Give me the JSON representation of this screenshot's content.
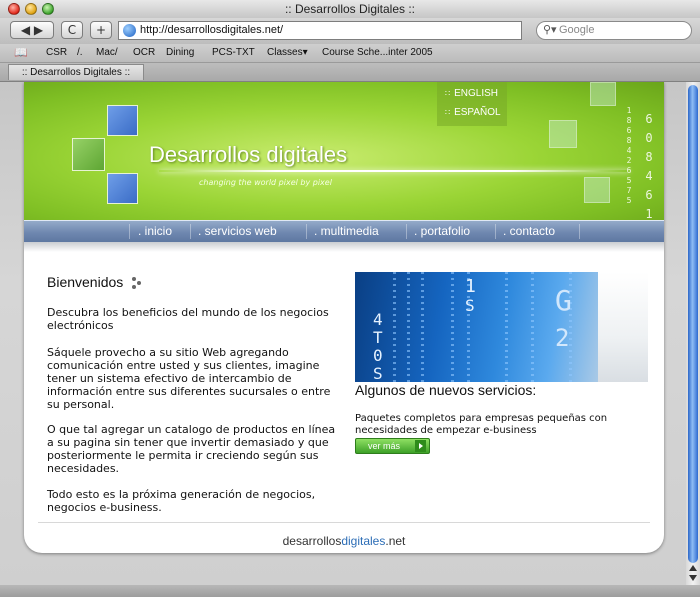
{
  "window": {
    "title": ":: Desarrollos Digitales ::"
  },
  "toolbar": {
    "back_glyph": "◀ ▶",
    "reload_glyph": "C",
    "add_glyph": "+",
    "url": "http://desarrollosdigitales.net/",
    "search_placeholder": "Google"
  },
  "bookmarks": [
    "CSR",
    "/.",
    "Mac/",
    "OCR",
    "Dining",
    "PCS-TXT",
    "Classes▾",
    "Course Sche...inter 2005"
  ],
  "tab": {
    "label": ":: Desarrollos Digitales ::"
  },
  "hero": {
    "brand": "Desarrollos digitales",
    "tagline": "changing the world pixel by pixel",
    "languages": [
      "ENGLISH",
      "ESPAÑOL"
    ],
    "digit_columns": [
      [
        "1",
        "8",
        "6",
        "8",
        "4",
        "2",
        "6",
        "5",
        "7",
        "5"
      ],
      [
        "6",
        "0",
        "8",
        "4",
        "6",
        "1"
      ]
    ]
  },
  "nav": {
    "items": [
      ". inicio",
      ". servicios  web",
      ". multimedia",
      ". portafolio",
      ". contacto"
    ]
  },
  "main": {
    "heading": "Bienvenidos",
    "paragraphs": [
      "Descubra los beneficios del mundo de los negocios electrónicos",
      "Sáquele provecho a su sitio Web agregando comunicación entre usted y sus clientes, imagine tener un sistema efectivo de intercambio de información entre sus diferentes sucursales o entre su personal.",
      "O que tal agregar un catalogo de productos en línea a su pagina sin tener que invertir demasiado y que posteriormente le permita ir creciendo según sus necesidades.",
      "Todo esto es la próxima generación de negocios, negocios e-business."
    ]
  },
  "sidebar": {
    "banner_chars": [
      "1",
      "S",
      "4",
      "T",
      "0",
      "S",
      "G",
      "2"
    ],
    "heading": "Algunos de nuevos servicios:",
    "text": "Paquetes completos para empresas pequeñas con necesidades de empezar e-business",
    "button": "ver más"
  },
  "footer": {
    "part1": "desarrollos",
    "part2": "digitales",
    "part3": ".net"
  },
  "colors": {
    "hero_green": "#9bd536",
    "nav_blue": "#6f88b0",
    "accent_blue": "#2c6db6",
    "button_green": "#3da128"
  }
}
